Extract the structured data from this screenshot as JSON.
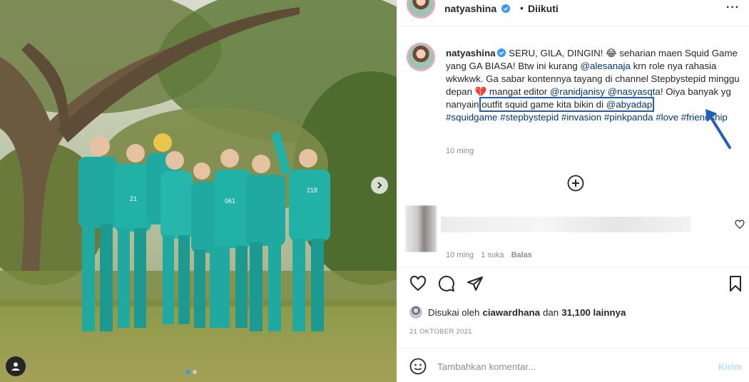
{
  "photo": {
    "alt_tag_icon": "user-tag-icon",
    "next_icon": "chevron-right-icon",
    "jersey_numbers": [
      "21",
      "061",
      "218"
    ]
  },
  "header": {
    "username": "natyashina",
    "verified_icon": "verified-badge-icon",
    "separator": "•",
    "follow_status": "Diikuti",
    "more_icon": "more-options-icon",
    "more_glyph": "···"
  },
  "caption": {
    "username": "natyashina",
    "parts": {
      "p1": " SERU, GILA, DINGIN! 😂 seharian maen Squid Game yang GA BIASA! Btw ini kurang ",
      "m1": "@alesanaja",
      "p2": " krn role nya rahasia wkwkwk. Ga sabar kontennya tayang di channel Stepbystepid minggu depan 💔 mangat editor ",
      "m2": "@ranidjanisy",
      "p3": " ",
      "m3": "@nasyasqta",
      "p4": "! Oiya banyak yg nanyain ",
      "hl_text": "outfit squid game kita bikin di ",
      "m4": "@abyadap",
      "h1": "#squidgame",
      "h2": "#stepbystepid",
      "h3": "#invasion",
      "h4": "#pinkpanda",
      "h5": "#love",
      "h6": "#friendship"
    },
    "time": "10 ming"
  },
  "load_more_icon": "plus-circle-icon",
  "comment": {
    "time": "10 ming",
    "likes": "1 suka",
    "reply": "Balas",
    "like_icon": "heart-outline-icon"
  },
  "actions": {
    "like_icon": "heart-icon",
    "comment_icon": "comment-icon",
    "share_icon": "share-icon",
    "save_icon": "bookmark-icon"
  },
  "likes": {
    "prefix": "Disukai oleh",
    "user": "ciawardhana",
    "middle": "dan",
    "count": "31,100 lainnya"
  },
  "date": "21 OKTOBER 2021",
  "comment_box": {
    "emoji_icon": "smiley-icon",
    "placeholder": "Tambahkan komentar...",
    "post_label": "Kirim"
  },
  "colors": {
    "link": "#00376b",
    "highlight_box": "#1f5fb5",
    "post_disabled": "#b2dffc",
    "tracksuit": "#1fa9a0"
  }
}
